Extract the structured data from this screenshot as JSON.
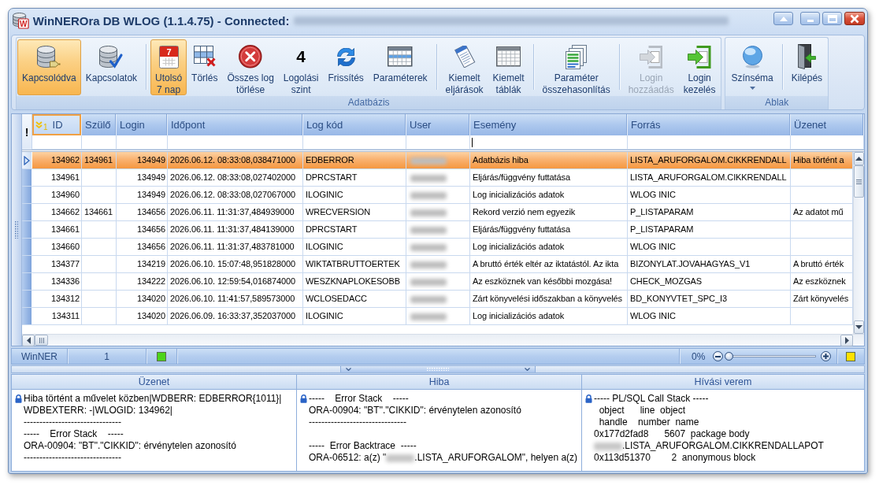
{
  "window": {
    "icon_letter": "W",
    "title": "WinNEROra DB WLOG (1.1.4.75) - Connected:",
    "connection_redacted": true
  },
  "ribbon": {
    "groups": [
      {
        "label": "Adatbázis",
        "items": [
          {
            "label": "Kapcsolódva",
            "checked": true,
            "disabled": false
          },
          {
            "label": "Kapcsolatok",
            "checked": false,
            "disabled": false
          },
          {
            "label": "Utolsó\n7 nap",
            "checked": true,
            "disabled": false,
            "separator_before": true,
            "icon_text": "7"
          },
          {
            "label": "Törlés",
            "checked": false,
            "disabled": false
          },
          {
            "label": "Összes log\ntörlése",
            "checked": false,
            "disabled": false
          },
          {
            "label": "Logolási\nszint",
            "checked": false,
            "disabled": false,
            "value": "4"
          },
          {
            "label": "Frissítés",
            "checked": false,
            "disabled": false
          },
          {
            "label": "Paraméterek",
            "checked": false,
            "disabled": false
          },
          {
            "label": "Kiemelt\neljárások",
            "checked": false,
            "disabled": false,
            "separator_before": true
          },
          {
            "label": "Kiemelt\ntáblák",
            "checked": false,
            "disabled": false
          },
          {
            "label": "Paraméter\nösszehasonlítás",
            "checked": false,
            "disabled": false,
            "separator_before": true
          },
          {
            "label": "Login\nhozzáadás",
            "checked": false,
            "disabled": true,
            "separator_before": true
          },
          {
            "label": "Login\nkezelés",
            "checked": false,
            "disabled": false
          }
        ]
      },
      {
        "label": "Ablak",
        "items": [
          {
            "label": "Színséma",
            "checked": false,
            "disabled": false,
            "dropdown": true
          },
          {
            "label": "Kilépés",
            "checked": false,
            "disabled": false,
            "separator_before": true
          }
        ]
      }
    ]
  },
  "grid": {
    "indicator_header": "!",
    "columns": [
      {
        "label": "ID",
        "focused": true,
        "sorted": true,
        "sort_index": "1",
        "filter_focused": false
      },
      {
        "label": "Szülő",
        "focused": false,
        "sorted": false,
        "filter_focused": false
      },
      {
        "label": "Login",
        "focused": false,
        "sorted": false,
        "filter_focused": false
      },
      {
        "label": "Időpont",
        "focused": false,
        "sorted": false,
        "filter_focused": false
      },
      {
        "label": "Log kód",
        "focused": false,
        "sorted": false,
        "filter_focused": false
      },
      {
        "label": "User",
        "focused": false,
        "sorted": false,
        "filter_focused": false
      },
      {
        "label": "Esemény",
        "focused": false,
        "sorted": false,
        "filter_focused": true
      },
      {
        "label": "Forrás",
        "focused": false,
        "sorted": false,
        "filter_focused": false
      },
      {
        "label": "Üzenet",
        "focused": false,
        "sorted": false,
        "filter_focused": false
      }
    ],
    "rows": [
      {
        "selected": true,
        "id": "134962",
        "parent": "134961",
        "login": "134949",
        "timestamp": "2026.06.12. 08:33:08,038471000",
        "log_code": "EDBERROR",
        "user_redacted": true,
        "event": "Adatbázis hiba",
        "source": "LISTA_ARUFORGALOM.CIKKRENDALL",
        "message": "Hiba történt a"
      },
      {
        "selected": false,
        "id": "134961",
        "login": "134949",
        "timestamp": "2026.06.12. 08:33:08,027402000",
        "log_code": "DPRCSTART",
        "user_redacted": true,
        "event": "Eljárás/függvény futtatása",
        "source": "LISTA_ARUFORGALOM.CIKKRENDALL"
      },
      {
        "selected": false,
        "id": "134960",
        "login": "134949",
        "timestamp": "2026.06.12. 08:33:08,027067000",
        "log_code": "ILOGINIC",
        "user_redacted": true,
        "event": "Log inicializációs adatok",
        "source": "WLOG INIC"
      },
      {
        "selected": false,
        "id": "134662",
        "parent": "134661",
        "login": "134656",
        "timestamp": "2026.06.11. 11:31:37,484939000",
        "log_code": "WRECVERSION",
        "user_redacted": true,
        "event": "Rekord verzió nem egyezik",
        "source": "P_LISTAPARAM",
        "message": "Az adatot mű"
      },
      {
        "selected": false,
        "id": "134661",
        "login": "134656",
        "timestamp": "2026.06.11. 11:31:37,484139000",
        "log_code": "DPRCSTART",
        "user_redacted": true,
        "event": "Eljárás/függvény futtatása",
        "source": "P_LISTAPARAM"
      },
      {
        "selected": false,
        "id": "134660",
        "login": "134656",
        "timestamp": "2026.06.11. 11:31:37,483781000",
        "log_code": "ILOGINIC",
        "user_redacted": true,
        "event": "Log inicializációs adatok",
        "source": "WLOG INIC"
      },
      {
        "selected": false,
        "id": "134377",
        "login": "134219",
        "timestamp": "2026.06.10. 15:07:48,951828000",
        "log_code": "WIKTATBRUTTOERTEK",
        "user_redacted": true,
        "event": "A bruttó érték eltér az iktatástól. Az ikta",
        "source": "BIZONYLAT.JOVAHAGYAS_V1",
        "message": "A bruttó érték"
      },
      {
        "selected": false,
        "id": "134336",
        "login": "134222",
        "timestamp": "2026.06.10. 12:59:54,016874000",
        "log_code": "WESZKNAPLOKESOBB",
        "user_redacted": true,
        "event": "Az eszköznek van későbbi mozgása!",
        "source": "CHECK_MOZGAS",
        "message": "Az eszköznek"
      },
      {
        "selected": false,
        "id": "134312",
        "login": "134020",
        "timestamp": "2026.06.10. 11:41:57,589573000",
        "log_code": "WCLOSEDACC",
        "user_redacted": true,
        "event": "Zárt könyvelési időszakban a könyvelés",
        "source": "BD_KONYVTET_SPC_I3",
        "message": "Zárt könyvelés"
      },
      {
        "selected": false,
        "id": "134311",
        "login": "134020",
        "timestamp": "2026.06.09. 16:33:37,352037000",
        "log_code": "ILOGINIC",
        "user_redacted": true,
        "event": "Log inicializációs adatok",
        "source": "WLOG INIC"
      }
    ]
  },
  "status_bar": {
    "left": [
      {
        "kind": "text",
        "text": "WinNER"
      },
      {
        "kind": "text",
        "text": "1"
      },
      {
        "kind": "indicator",
        "color": "#4cd41a"
      }
    ],
    "right": [
      {
        "kind": "zoom",
        "text": "0%",
        "level": 0
      },
      {
        "kind": "indicator",
        "color": "#ffe100"
      }
    ]
  },
  "detail_panels": [
    {
      "title": "Üzenet",
      "locked": true,
      "lines": [
        {
          "kind": "text",
          "text": "Hiba történt a művelet közben|WDBERR: EDBERROR{1011}|"
        },
        {
          "kind": "text",
          "text": "WDBEXTERR: -|WLOGID: 134962|"
        },
        {
          "kind": "text",
          "text": "-------------------------------"
        },
        {
          "kind": "text",
          "text": "-----    Error Stack    -----"
        },
        {
          "kind": "text",
          "text": "ORA-00904: \"BT\".\"CIKKID\": érvénytelen azonosító"
        },
        {
          "kind": "text",
          "text": "-------------------------------"
        }
      ]
    },
    {
      "title": "Hiba",
      "locked": true,
      "lines": [
        {
          "kind": "text",
          "text": "-----    Error Stack    -----"
        },
        {
          "kind": "text",
          "text": "ORA-00904: \"BT\".\"CIKKID\": érvénytelen azonosító"
        },
        {
          "kind": "text",
          "text": "-------------------------------"
        },
        {
          "kind": "blank"
        },
        {
          "kind": "text",
          "text": "-----  Error Backtrace  -----"
        },
        {
          "kind": "mixed",
          "segments": [
            {
              "kind": "text",
              "text": "ORA-06512: a(z) \""
            },
            {
              "kind": "redacted"
            },
            {
              "kind": "text",
              "text": ".LISTA_ARUFORGALOM\", helyen a(z)"
            }
          ]
        }
      ]
    },
    {
      "title": "Hívási verem",
      "locked": true,
      "lines": [
        {
          "kind": "text",
          "text": "----- PL/SQL Call Stack -----"
        },
        {
          "kind": "text",
          "text": "  object      line  object"
        },
        {
          "kind": "text",
          "text": "  handle    number  name"
        },
        {
          "kind": "text",
          "text": "0x177d2fad8      5607  package body"
        },
        {
          "kind": "mixed",
          "segments": [
            {
              "kind": "redacted"
            },
            {
              "kind": "text",
              "text": ".LISTA_ARUFORGALOM.CIKKRENDALLAPOT"
            }
          ]
        },
        {
          "kind": "text",
          "text": "0x113d51370        2  anonymous block"
        }
      ]
    }
  ]
}
